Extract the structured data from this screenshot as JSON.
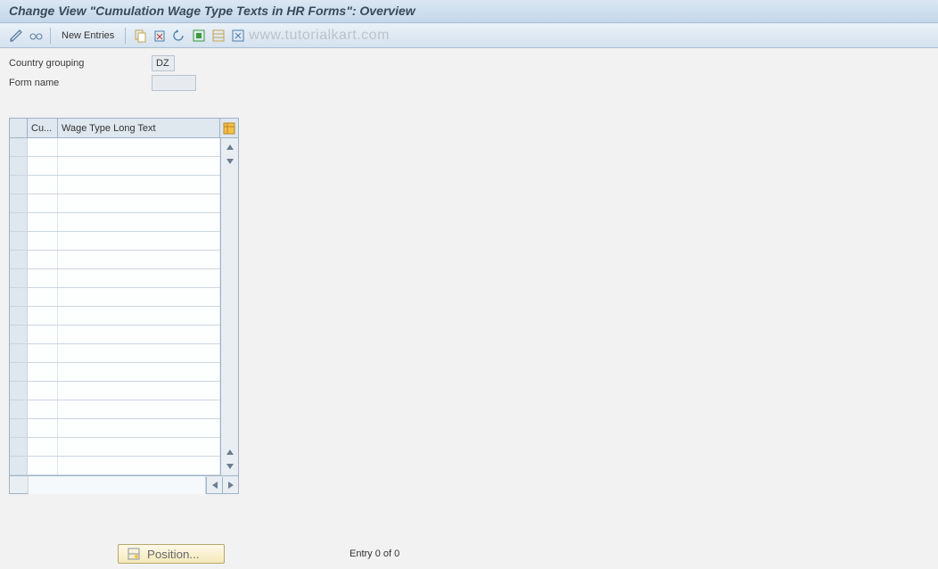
{
  "title": "Change View \"Cumulation Wage Type Texts in HR Forms\": Overview",
  "toolbar": {
    "new_entries": "New Entries"
  },
  "watermark": "www.tutorialkart.com",
  "fields": {
    "country_grouping_label": "Country grouping",
    "country_grouping_value": "DZ",
    "form_name_label": "Form name",
    "form_name_value": ""
  },
  "table": {
    "col1": "Cu...",
    "col2": "Wage Type Long Text",
    "rows": [
      {
        "c1": "",
        "c2": ""
      },
      {
        "c1": "",
        "c2": ""
      },
      {
        "c1": "",
        "c2": ""
      },
      {
        "c1": "",
        "c2": ""
      },
      {
        "c1": "",
        "c2": ""
      },
      {
        "c1": "",
        "c2": ""
      },
      {
        "c1": "",
        "c2": ""
      },
      {
        "c1": "",
        "c2": ""
      },
      {
        "c1": "",
        "c2": ""
      },
      {
        "c1": "",
        "c2": ""
      },
      {
        "c1": "",
        "c2": ""
      },
      {
        "c1": "",
        "c2": ""
      },
      {
        "c1": "",
        "c2": ""
      },
      {
        "c1": "",
        "c2": ""
      },
      {
        "c1": "",
        "c2": ""
      },
      {
        "c1": "",
        "c2": ""
      },
      {
        "c1": "",
        "c2": ""
      },
      {
        "c1": "",
        "c2": ""
      }
    ]
  },
  "bottom": {
    "position_label": "Position...",
    "entry_text": "Entry 0 of 0"
  }
}
